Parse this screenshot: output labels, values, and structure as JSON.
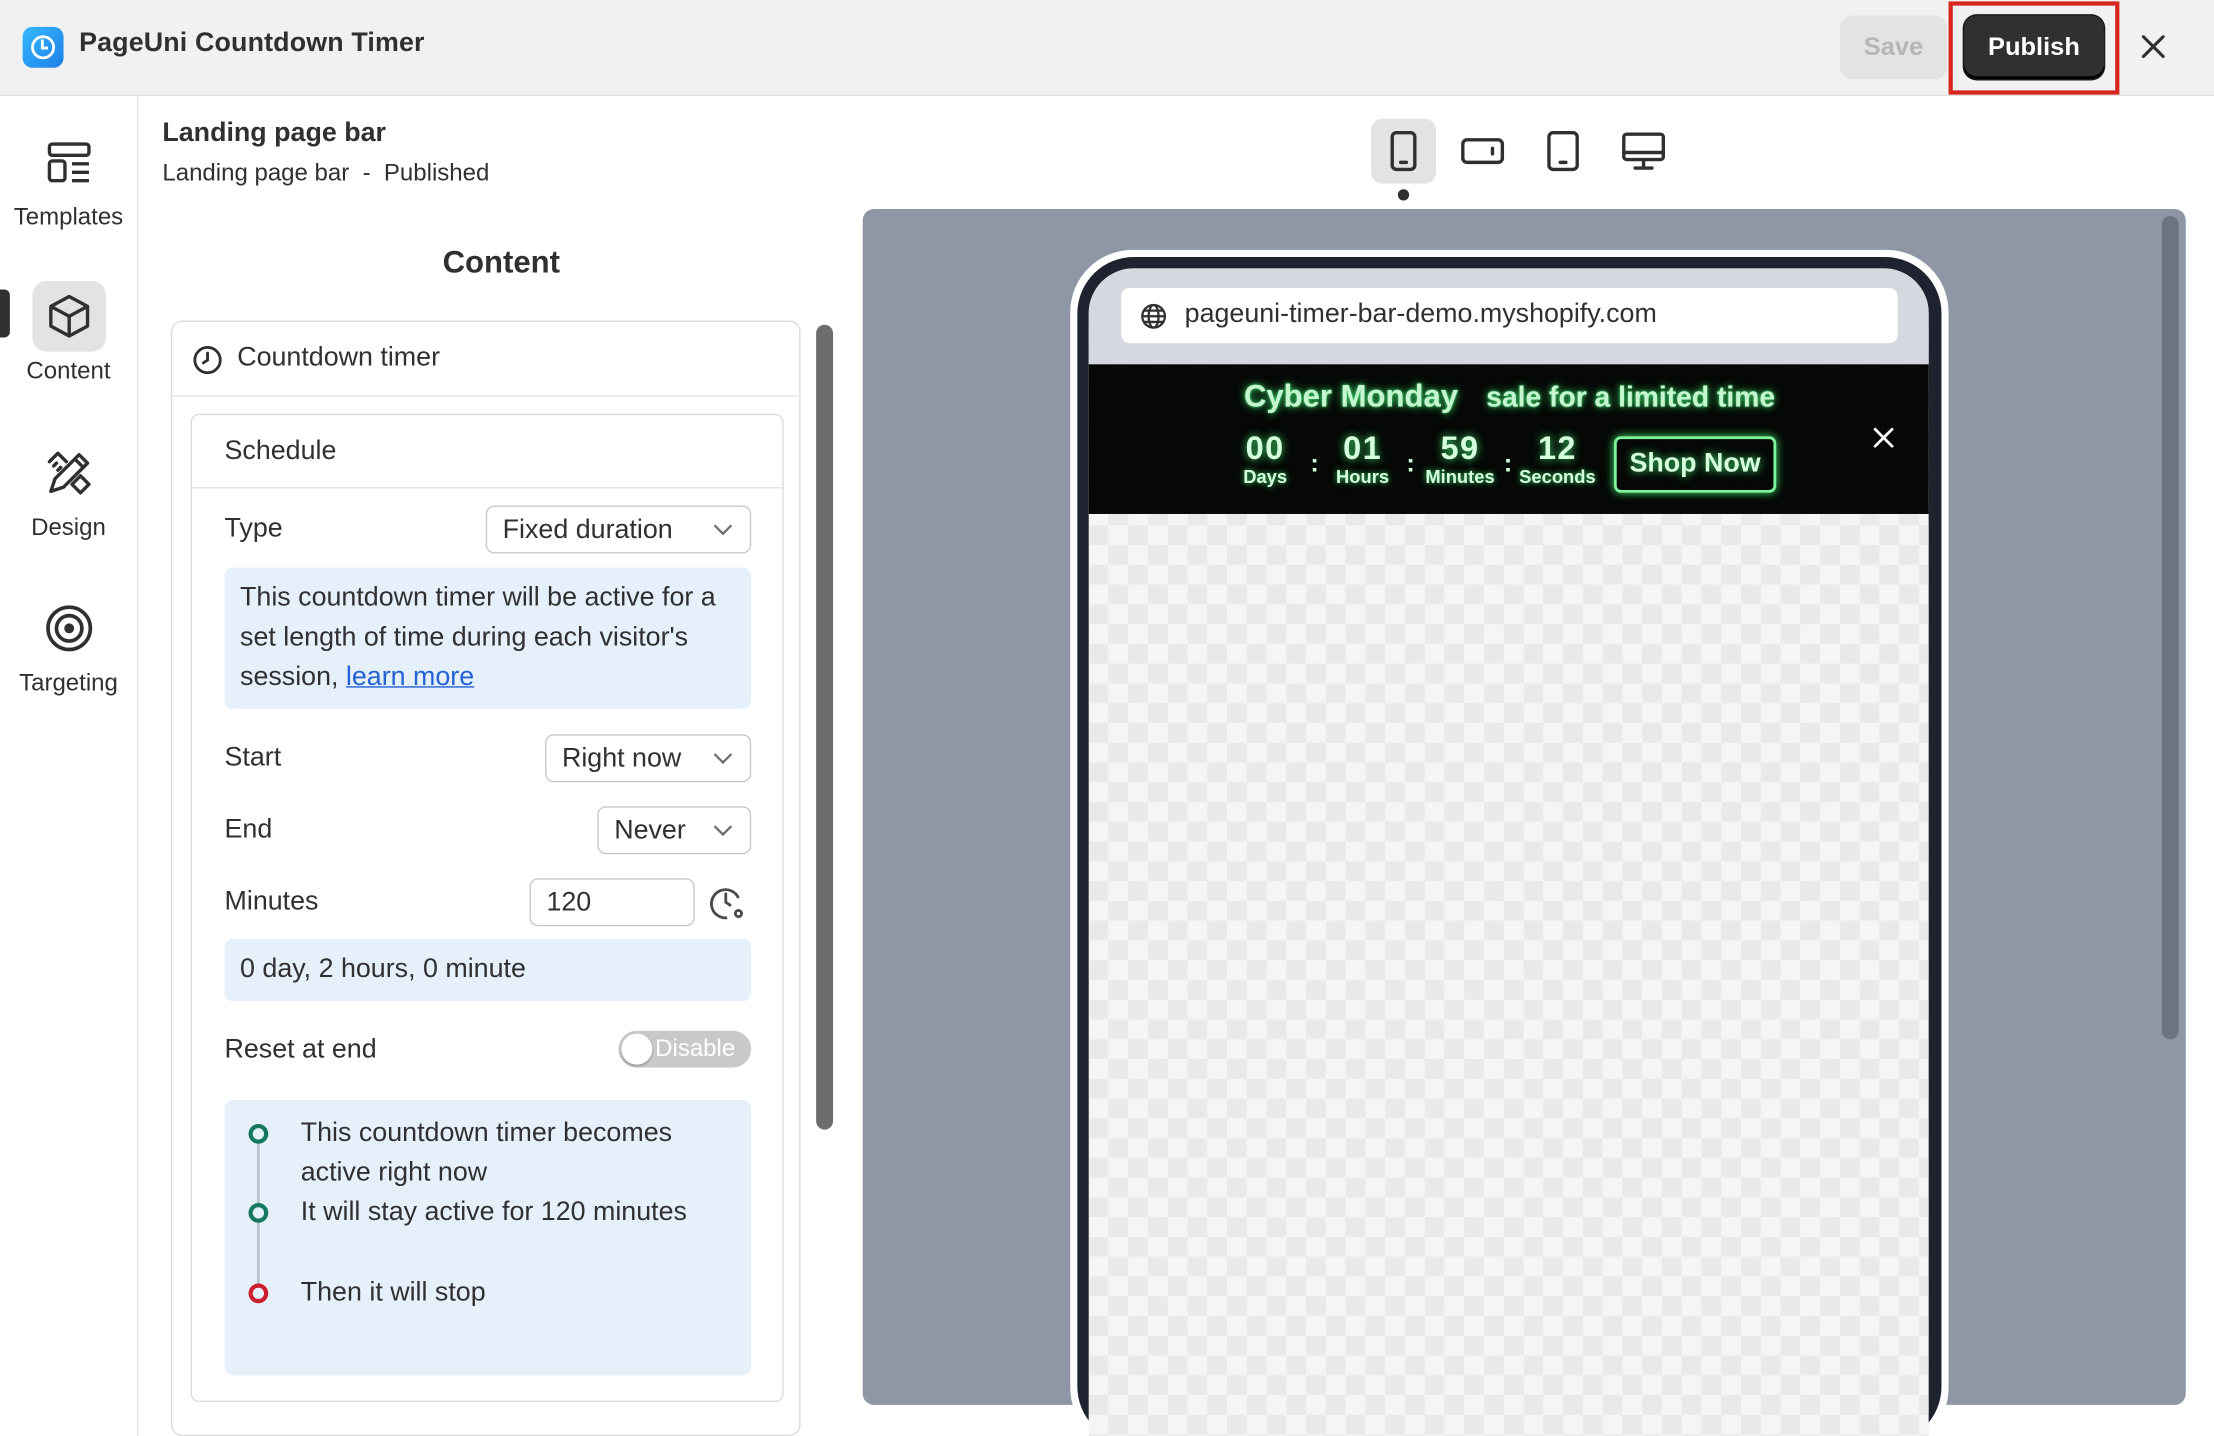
{
  "app": {
    "title": "PageUni Countdown Timer"
  },
  "toolbar": {
    "save_label": "Save",
    "publish_label": "Publish"
  },
  "rail": {
    "items": [
      {
        "label": "Templates",
        "icon": "templates-icon"
      },
      {
        "label": "Content",
        "icon": "cube-icon",
        "active": true
      },
      {
        "label": "Design",
        "icon": "design-tools-icon"
      },
      {
        "label": "Targeting",
        "icon": "target-icon"
      }
    ]
  },
  "page": {
    "name": "Landing page bar",
    "status": "Landing page bar  -  Published"
  },
  "devices": {
    "selected": "mobile",
    "options": [
      "mobile",
      "mobile-landscape",
      "tablet",
      "desktop"
    ]
  },
  "content": {
    "title": "Content",
    "section": "Countdown timer",
    "schedule": {
      "title": "Schedule",
      "type_label": "Type",
      "type_value": "Fixed duration",
      "type_info": "This countdown timer will be active for a set length of time during each visitor's session,",
      "type_info_link": "learn more",
      "start_label": "Start",
      "start_value": "Right now",
      "end_label": "End",
      "end_value": "Never",
      "minutes_label": "Minutes",
      "minutes_value": "120",
      "duration_text": "0 day, 2 hours, 0 minute",
      "reset_label": "Reset at end",
      "reset_value": "Disable",
      "timeline": [
        "This countdown timer becomes active right now",
        "It will stay active for 120 minutes",
        "Then it will stop"
      ]
    }
  },
  "preview": {
    "url": "pageuni-timer-bar-demo.myshopify.com",
    "bar": {
      "headline_bold": "Cyber Monday",
      "headline_rest": "sale for a limited time",
      "days": "00",
      "days_label": "Days",
      "hours": "01",
      "hours_label": "Hours",
      "minutes": "59",
      "minutes_label": "Minutes",
      "seconds": "12",
      "seconds_label": "Seconds",
      "button": "Shop Now"
    }
  },
  "colors": {
    "accent_dark": "#303030",
    "highlight_red": "#d7261e",
    "info_bg": "#e6f0fb",
    "timer_green": "#3fdc6d"
  }
}
